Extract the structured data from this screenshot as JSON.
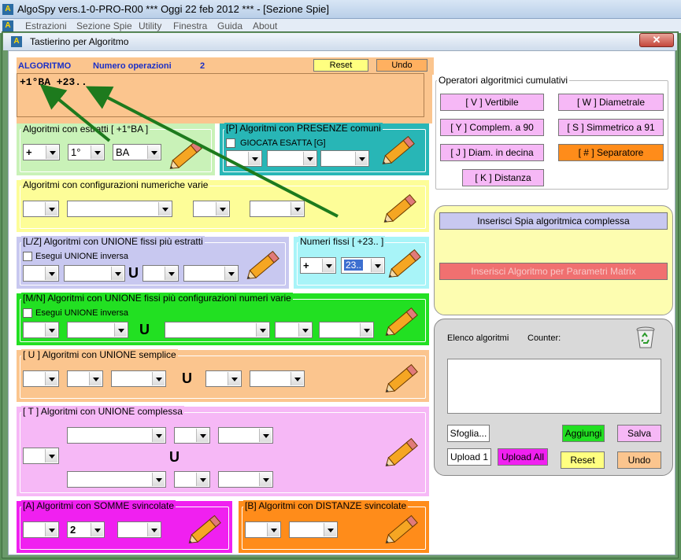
{
  "app": {
    "title": "AlgoSpy vers.1-0-PRO-R00  ***  Oggi 22 feb 2012  ***  - [Sezione Spie]",
    "menu": [
      "Estrazioni",
      "Sezione Spie",
      "Utility",
      "Finestra",
      "Guida",
      "About"
    ]
  },
  "dialog": {
    "title": "Tastierino per Algoritmo",
    "close": "✕"
  },
  "header": {
    "algoritmo": "ALGORITMO",
    "numero_label": "Numero operazioni",
    "numero_value": "2",
    "reset": "Reset",
    "undo": "Undo"
  },
  "formula": "+1°BA +23..",
  "estratti": {
    "title": "Algoritmi con estratti  [ +1°BA ]",
    "sign": "+",
    "pos": "1°",
    "ruota": "BA"
  },
  "presenze": {
    "title": "[P] Algoritmi con PRESENZE comuni",
    "checkbox": "GIOCATA ESATTA  [G]"
  },
  "config": {
    "title": "Algoritmi con configurazioni numeriche varie"
  },
  "lz": {
    "title": "[L/Z] Algoritmi con UNIONE fissi più estratti",
    "checkbox": "Esegui UNIONE inversa",
    "u": "U"
  },
  "fissi": {
    "title": "Numeri fissi  [ +23.. ]",
    "sign": "+",
    "value": "23.."
  },
  "mn": {
    "title": "[M/N] Algoritmi con UNIONE fissi più configurazioni numeri varie",
    "checkbox": "Esegui UNIONE inversa",
    "u": "U"
  },
  "usemplice": {
    "title": "[ U ] Algoritmi con UNIONE semplice",
    "u": "U"
  },
  "ucomplessa": {
    "title": "[ T ] Algoritmi con UNIONE complessa",
    "u": "U"
  },
  "somme": {
    "title": "[A] Algoritmi con SOMME svincolate",
    "value": "2"
  },
  "distanze": {
    "title": "[B] Algoritmi con DISTANZE svincolate"
  },
  "operatori": {
    "title": "Operatori algoritmici cumulativi",
    "buttons": [
      "[ V ] Vertibile",
      "[ W ] Diametrale",
      "[ Y ] Complem. a 90",
      "[ S ] Simmetrico  a 91",
      "[ J ] Diam. in decina",
      "[ # ] Separatore",
      "[ K ] Distanza"
    ]
  },
  "spia": {
    "button1": "Inserisci Spia algoritmica complessa",
    "button2": "Inserisci Algoritmo per Parametri Matrix"
  },
  "elenco": {
    "title": "Elenco algoritmi",
    "counter": "Counter:",
    "sfoglia": "Sfoglia...",
    "aggiungi": "Aggiungi",
    "salva": "Salva",
    "upload1": "Upload 1",
    "uploadall": "Upload All",
    "reset": "Reset",
    "undo": "Undo"
  },
  "colors": {
    "orange": "#fbc58e",
    "green_light": "#c9f2b8",
    "teal": "#28b6b6",
    "yellow": "#fdfd98",
    "lavender": "#c8c8f0",
    "cyan": "#a8f4f8",
    "green": "#22e022",
    "pink": "#f6b8f6",
    "magenta": "#f020f0",
    "deep_orange": "#ff8c1a",
    "arrow": "#1d7a1d"
  }
}
